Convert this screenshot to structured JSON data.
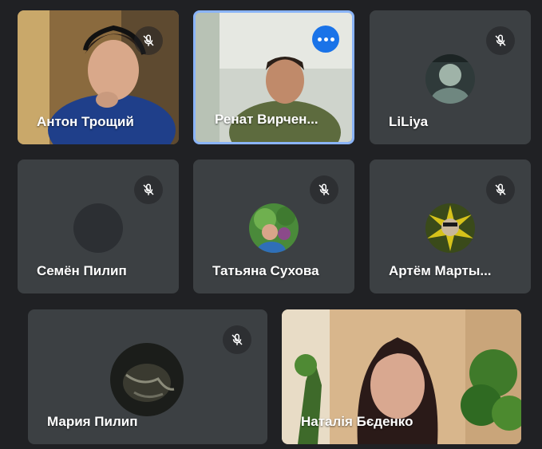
{
  "participants": [
    {
      "name": "Антон Трощий",
      "muted": true
    },
    {
      "name": "Ренат Вирчен...",
      "active_speaker": true
    },
    {
      "name": "LiLiya",
      "muted": true
    },
    {
      "name": "Семён Пилип",
      "muted": true
    },
    {
      "name": "Татьяна Сухова",
      "muted": true
    },
    {
      "name": "Артём Марты...",
      "muted": true
    },
    {
      "name": "Мария Пилип",
      "muted": true
    },
    {
      "name": "Наталія Бєденко"
    }
  ],
  "icons": {
    "mute": "mic-off-icon",
    "more": "more-options-icon"
  },
  "colors": {
    "background": "#202124",
    "tile": "#3c4043",
    "active_border": "#8ab4f8",
    "more_button": "#1a73e8"
  }
}
